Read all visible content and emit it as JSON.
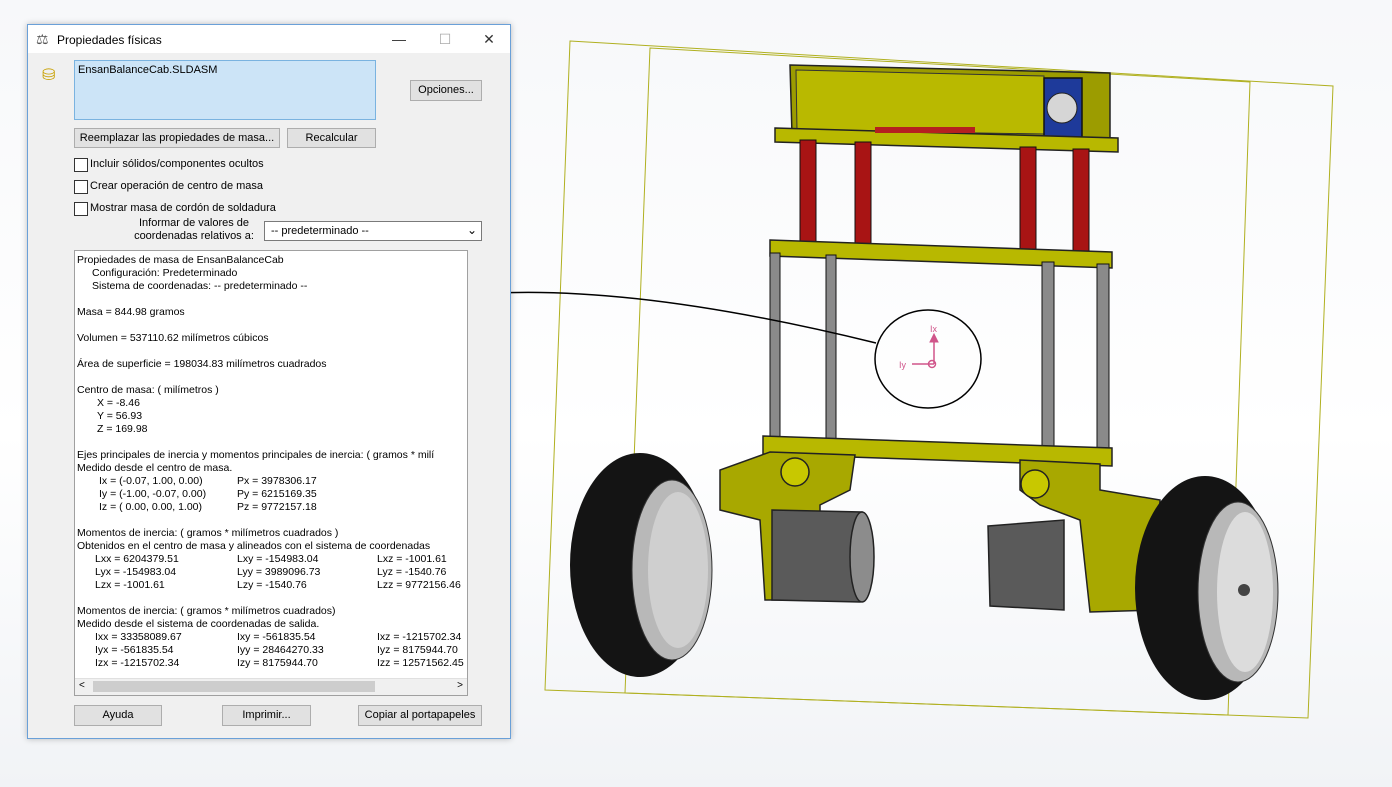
{
  "window": {
    "title": "Propiedades físicas",
    "minimize_glyph": "—",
    "maximize_glyph": "☐",
    "close_glyph": "✕"
  },
  "selection": {
    "component": "EnsanBalanceCab.SLDASM"
  },
  "buttons": {
    "options": "Opciones...",
    "override_mass": "Reemplazar las propiedades de masa...",
    "recalculate": "Recalcular",
    "help": "Ayuda",
    "print": "Imprimir...",
    "copy": "Copiar al portapapeles"
  },
  "checkboxes": [
    {
      "label": "Incluir sólidos/componentes ocultos",
      "checked": false
    },
    {
      "label": "Crear operación de centro de masa",
      "checked": false
    },
    {
      "label": "Mostrar masa de cordón de soldadura",
      "checked": false
    }
  ],
  "coord_report": {
    "label_line1": "Informar de valores de",
    "label_line2": "coordenadas relativos a:",
    "selected": "-- predeterminado --"
  },
  "results": {
    "header": "Propiedades de masa de EnsanBalanceCab",
    "config": "Configuración:  Predeterminado",
    "coord_system": "Sistema de coordenadas:  -- predeterminado --",
    "mass": "Masa = 844.98 gramos",
    "volume": "Volumen = 537110.62 milímetros cúbicos",
    "surface": "Área de superficie = 198034.83  milímetros cuadrados",
    "com_title": "Centro de masa: ( milímetros )",
    "com_x": "X = -8.46",
    "com_y": "Y = 56.93",
    "com_z": "Z = 169.98",
    "principal_title": "Ejes principales de inercia y momentos principales de inercia: ( gramos *  milí",
    "principal_measured": "Medido desde el centro de masa.",
    "ix": "Ix = (-0.07,  1.00,  0.00)",
    "iy": "Iy = (-1.00, -0.07,  0.00)",
    "iz": "Iz = ( 0.00,  0.00,  1.00)",
    "px": "Px = 3978306.17",
    "py": "Py = 6215169.35",
    "pz": "Pz = 9772157.18",
    "moments1_title": "Momentos de inercia: ( gramos *  milímetros cuadrados )",
    "moments1_sub": "Obtenidos en el centro de masa y alineados con el sistema de coordenadas",
    "lxx": "Lxx = 6204379.51",
    "lxy": "Lxy = -154983.04",
    "lxz": "Lxz = -1001.61",
    "lyx": "Lyx = -154983.04",
    "lyy": "Lyy = 3989096.73",
    "lyz": "Lyz = -1540.76",
    "lzx": "Lzx = -1001.61",
    "lzy": "Lzy = -1540.76",
    "lzz": "Lzz = 9772156.46",
    "moments2_title": "Momentos de inercia: ( gramos *  milímetros cuadrados)",
    "moments2_sub": "Medido desde el sistema de coordenadas de salida.",
    "ixx": "Ixx = 33358089.67",
    "ixy": "Ixy = -561835.54",
    "ixz": "Ixz = -1215702.34",
    "iyx": "Iyx = -561835.54",
    "iyy": "Iyy = 28464270.33",
    "iyz": "Iyz = 8175944.70",
    "izx": "Izx = -1215702.34",
    "izy": "Izy = 8175944.70",
    "izz": "Izz = 12571562.45"
  },
  "model": {
    "triad_x_label": "Ix",
    "triad_y_label": "Iy"
  },
  "colors": {
    "frame_yellow": "#a8a800",
    "rod_red": "#b51010",
    "rod_gray": "#7a7a7a",
    "tire": "#121212",
    "motor": "#5e5e5e",
    "triad": "#d0558a"
  }
}
